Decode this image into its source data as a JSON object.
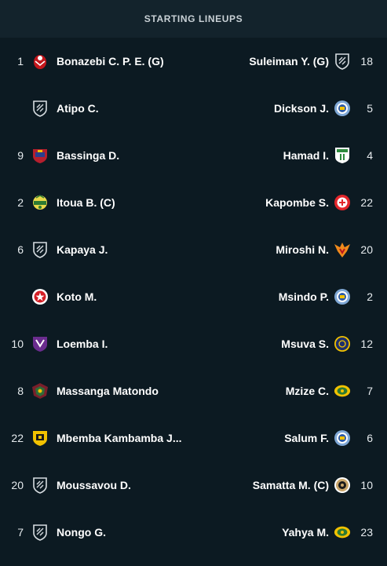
{
  "header": {
    "title": "STARTING LINEUPS"
  },
  "home": [
    {
      "number": "1",
      "name": "Bonazebi C. P. E. (G)",
      "crest": "red-eagle-crest"
    },
    {
      "number": "",
      "name": "Atipo C.",
      "crest": "generic-shield-icon"
    },
    {
      "number": "9",
      "name": "Bassinga D.",
      "crest": "red-blue-shield-crest"
    },
    {
      "number": "2",
      "name": "Itoua B. (C)",
      "crest": "green-yellow-crest"
    },
    {
      "number": "6",
      "name": "Kapaya J.",
      "crest": "generic-shield-icon"
    },
    {
      "number": "",
      "name": "Koto M.",
      "crest": "red-star-round-crest"
    },
    {
      "number": "10",
      "name": "Loemba I.",
      "crest": "purple-shield-crest"
    },
    {
      "number": "8",
      "name": "Massanga Matondo",
      "crest": "maroon-green-crest"
    },
    {
      "number": "22",
      "name": "Mbemba Kambamba J...",
      "crest": "yellow-black-crest"
    },
    {
      "number": "20",
      "name": "Moussavou D.",
      "crest": "generic-shield-icon"
    },
    {
      "number": "7",
      "name": "Nongo G.",
      "crest": "generic-shield-icon"
    }
  ],
  "away": [
    {
      "number": "18",
      "name": "Suleiman Y. (G)",
      "crest": "generic-shield-icon"
    },
    {
      "number": "5",
      "name": "Dickson J.",
      "crest": "blue-round-crest"
    },
    {
      "number": "4",
      "name": "Hamad I.",
      "crest": "green-white-crest"
    },
    {
      "number": "22",
      "name": "Kapombe S.",
      "crest": "red-white-round-crest"
    },
    {
      "number": "20",
      "name": "Miroshi N.",
      "crest": "orange-eagle-crest"
    },
    {
      "number": "2",
      "name": "Msindo P.",
      "crest": "blue-round-crest"
    },
    {
      "number": "12",
      "name": "Msuva S.",
      "crest": "navy-round-crest"
    },
    {
      "number": "7",
      "name": "Mzize C.",
      "crest": "yellow-green-crest"
    },
    {
      "number": "6",
      "name": "Salum F.",
      "crest": "blue-round-crest"
    },
    {
      "number": "10",
      "name": "Samatta M. (C)",
      "crest": "tan-round-crest"
    },
    {
      "number": "23",
      "name": "Yahya M.",
      "crest": "yellow-green-crest"
    }
  ]
}
